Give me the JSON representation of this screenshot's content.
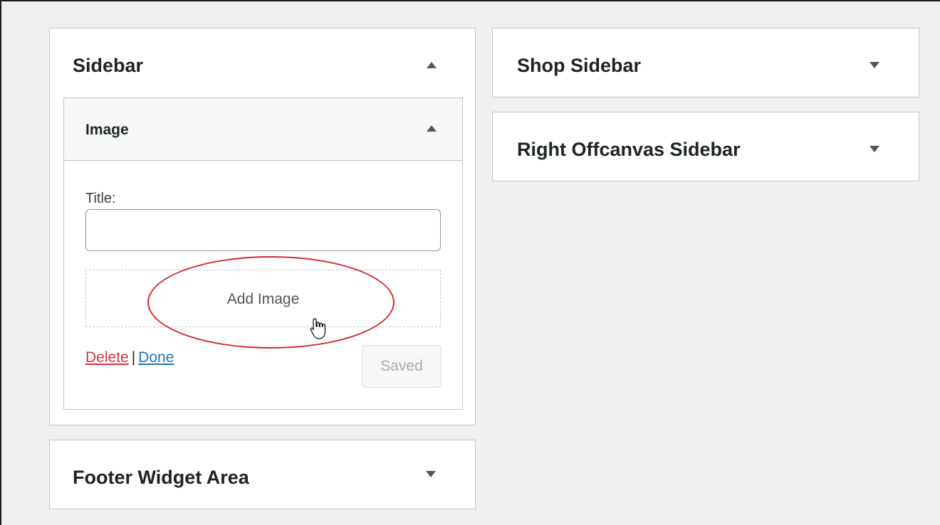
{
  "sidebar_area": {
    "title": "Sidebar",
    "widget": {
      "title": "Image",
      "title_label": "Title:",
      "title_value": "",
      "add_image_label": "Add Image",
      "delete_label": "Delete",
      "separator": "|",
      "done_label": "Done",
      "saved_label": "Saved"
    }
  },
  "shop_area": {
    "title": "Shop Sidebar"
  },
  "offcanvas_area": {
    "title": "Right Offcanvas Sidebar"
  },
  "footer_area": {
    "title": "Footer Widget Area"
  },
  "colors": {
    "background": "#f0f0f1",
    "highlight": "#d7262d",
    "delete": "#d63638",
    "done": "#2271b1"
  }
}
